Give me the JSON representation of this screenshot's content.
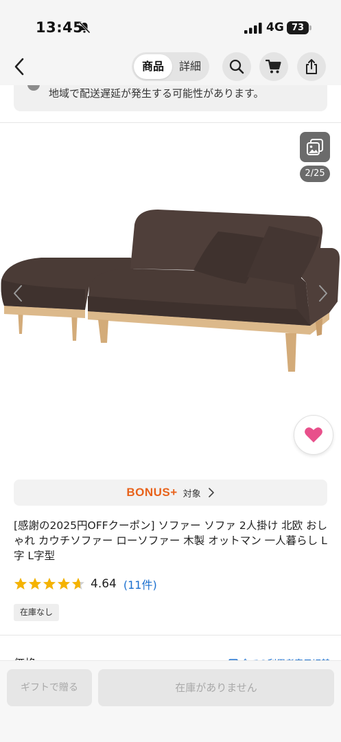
{
  "status_bar": {
    "time": "13:45",
    "network": "4G",
    "battery": "73"
  },
  "nav": {
    "tabs": [
      {
        "label": "商品",
        "active": true
      },
      {
        "label": "詳細",
        "active": false
      }
    ],
    "icons": [
      "back-arrow-icon",
      "search-icon",
      "cart-icon",
      "share-icon"
    ]
  },
  "notice": {
    "text": "地域で配送遅延が発生する可能性があります。"
  },
  "gallery": {
    "counter": "2/25",
    "favorite_color": "#e8508b"
  },
  "bonus": {
    "logo_text": "BONUS",
    "logo_plus": "+",
    "target_label": "対象",
    "color": "#e8631c"
  },
  "product": {
    "title": "[感謝の2025円OFFクーポン] ソファー ソファ 2人掛け 北欧 おしゃれ カウチソファー ローソファー 木製 オットマン 一人暮らし L字 L字型",
    "rating": 4.64,
    "rating_text": "4.64",
    "review_count": "(11件)",
    "stock_status": "在庫なし"
  },
  "price": {
    "label": "価格",
    "link_text": "全ての利用者表示切替"
  },
  "bottom_bar": {
    "gift_button": "ギフトで贈る",
    "stock_button": "在庫がありません"
  },
  "colors": {
    "star": "#f5b301",
    "link": "#1a6fcf",
    "sofa_fabric": "#4a3b36",
    "sofa_wood": "#d8b283"
  }
}
